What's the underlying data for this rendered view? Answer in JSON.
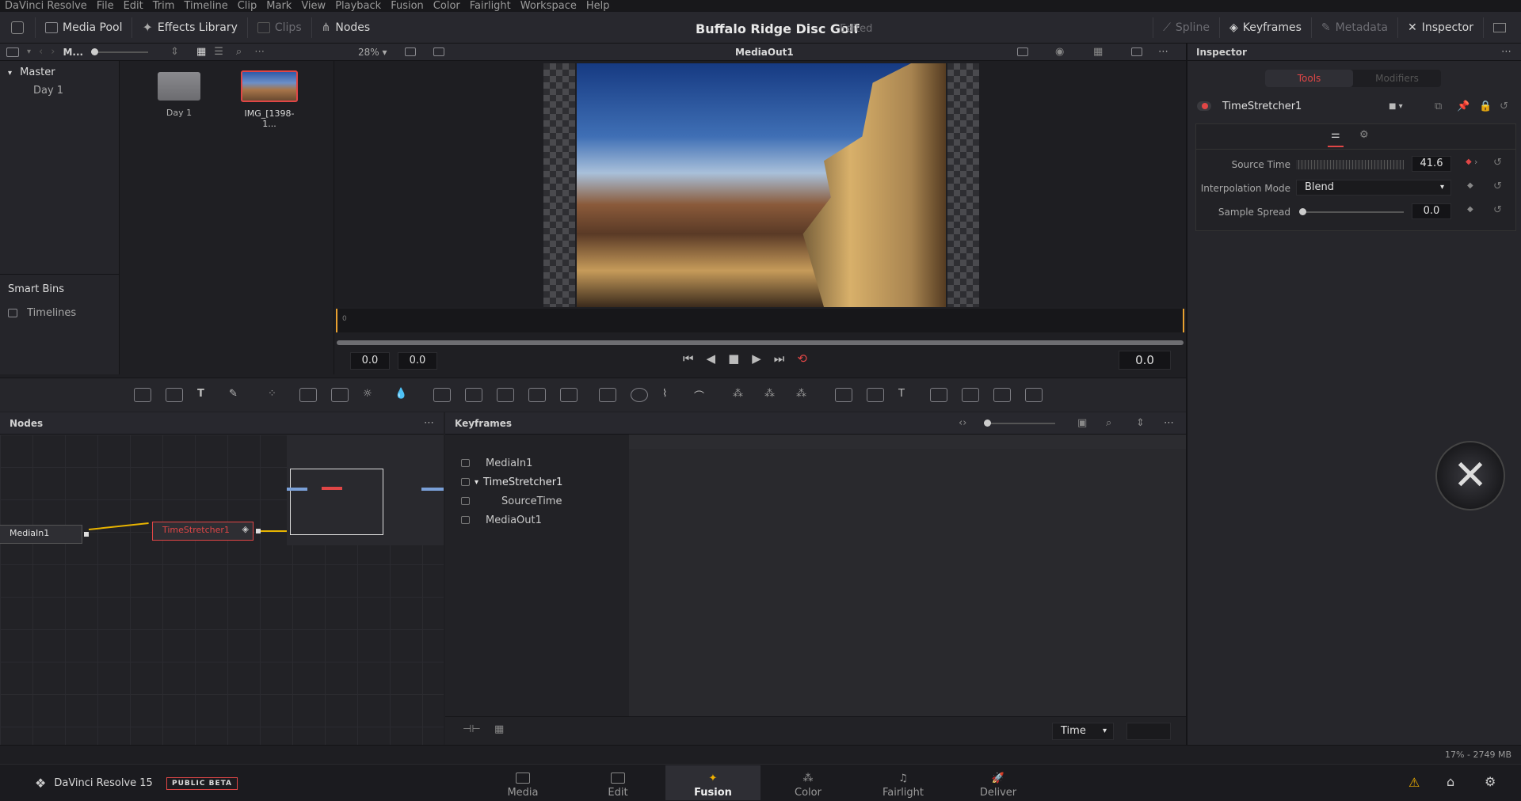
{
  "menu": [
    "DaVinci Resolve",
    "File",
    "Edit",
    "Trim",
    "Timeline",
    "Clip",
    "Mark",
    "View",
    "Playback",
    "Fusion",
    "Color",
    "Fairlight",
    "Workspace",
    "Help"
  ],
  "toolbar": {
    "media_pool": "Media Pool",
    "effects_library": "Effects Library",
    "clips": "Clips",
    "nodes": "Nodes",
    "spline": "Spline",
    "keyframes": "Keyframes",
    "metadata": "Metadata",
    "inspector": "Inspector"
  },
  "project": {
    "title": "Buffalo Ridge Disc Golf",
    "status": "Edited"
  },
  "mediapool": {
    "header_label": "M...",
    "master": "Master",
    "bins": [
      "Day 1"
    ],
    "smart_bins": "Smart Bins",
    "smart_items": [
      "Timelines"
    ],
    "clips": [
      {
        "name": "Day 1",
        "type": "folder"
      },
      {
        "name": "IMG_[1398-1...",
        "type": "image"
      }
    ]
  },
  "viewer": {
    "zoom": "28%",
    "title": "MediaOut1",
    "ruler_start": "0",
    "time_in": "0.0",
    "time_out": "0.0",
    "current_time": "0.0"
  },
  "nodes_panel": {
    "title": "Nodes",
    "nodes": [
      "MediaIn1",
      "TimeStretcher1"
    ]
  },
  "keyframes_panel": {
    "title": "Keyframes",
    "tracks": [
      "MediaIn1",
      "TimeStretcher1",
      "SourceTime",
      "MediaOut1"
    ],
    "time_select": "Time"
  },
  "inspector": {
    "title": "Inspector",
    "tabs": [
      "Tools",
      "Modifiers"
    ],
    "tool_name": "TimeStretcher1",
    "params": [
      {
        "label": "Source Time",
        "value": "41.6"
      },
      {
        "label": "Interpolation Mode",
        "value": "Blend"
      },
      {
        "label": "Sample Spread",
        "value": "0.0"
      }
    ]
  },
  "status": {
    "memory": "17% - 2749 MB"
  },
  "bottom": {
    "app_name": "DaVinci Resolve 15",
    "badge": "PUBLIC BETA",
    "pages": [
      "Media",
      "Edit",
      "Fusion",
      "Color",
      "Fairlight",
      "Deliver"
    ],
    "active_page": "Fusion"
  },
  "colors": {
    "accent_red": "#e04646",
    "active_orange": "#f0b000",
    "link_yellow": "#e8b400"
  }
}
